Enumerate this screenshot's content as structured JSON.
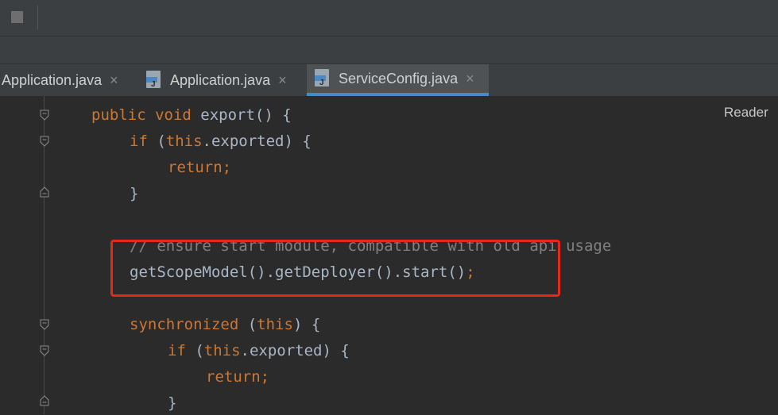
{
  "tabs": [
    {
      "label": "Application.java",
      "active": false,
      "has_icon": false
    },
    {
      "label": "Application.java",
      "active": false,
      "has_icon": true
    },
    {
      "label": "ServiceConfig.java",
      "active": true,
      "has_icon": true
    }
  ],
  "tab_close_glyph": "×",
  "editor": {
    "reader_mode_label": "Reader",
    "lines": [
      [
        {
          "t": "public",
          "c": "kw"
        },
        {
          "t": " ",
          "c": "plain"
        },
        {
          "t": "void",
          "c": "kw"
        },
        {
          "t": " export() {",
          "c": "plain"
        }
      ],
      [
        {
          "t": "if",
          "c": "kw"
        },
        {
          "t": " (",
          "c": "plain"
        },
        {
          "t": "this",
          "c": "kw"
        },
        {
          "t": ".exported) {",
          "c": "plain"
        }
      ],
      [
        {
          "t": "return",
          "c": "kw"
        },
        {
          "t": ";",
          "c": "kw"
        }
      ],
      [
        {
          "t": "}",
          "c": "plain"
        }
      ],
      [],
      [
        {
          "t": "// ensure start module, compatible with old api usage",
          "c": "cm"
        }
      ],
      [
        {
          "t": "getScopeModel().getDeployer().start()",
          "c": "plain"
        },
        {
          "t": ";",
          "c": "kw"
        }
      ],
      [],
      [
        {
          "t": "synchronized",
          "c": "kw"
        },
        {
          "t": " (",
          "c": "plain"
        },
        {
          "t": "this",
          "c": "kw"
        },
        {
          "t": ") {",
          "c": "plain"
        }
      ],
      [
        {
          "t": "if",
          "c": "kw"
        },
        {
          "t": " (",
          "c": "plain"
        },
        {
          "t": "this",
          "c": "kw"
        },
        {
          "t": ".exported) {",
          "c": "plain"
        }
      ],
      [
        {
          "t": "return",
          "c": "kw"
        },
        {
          "t": ";",
          "c": "kw"
        }
      ],
      [
        {
          "t": "}",
          "c": "plain"
        }
      ]
    ]
  },
  "colors": {
    "keyword": "#cc7832",
    "text": "#a9b7c6",
    "comment": "#808080",
    "highlight_box": "#e8261a",
    "active_tab_underline": "#4a88c7"
  }
}
